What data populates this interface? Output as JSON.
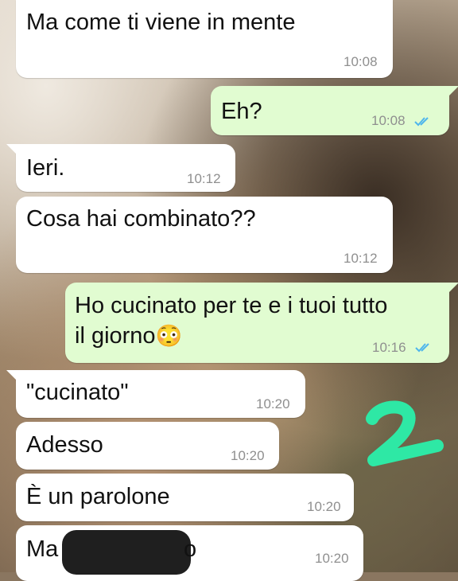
{
  "messages": [
    {
      "text": "Ma come ti viene in mente",
      "time": "10:08"
    },
    {
      "text": "Eh?",
      "time": "10:08"
    },
    {
      "text": "Ieri.",
      "time": "10:12"
    },
    {
      "text": "Cosa hai combinato??",
      "time": "10:12"
    },
    {
      "line1": "Ho cucinato per te e i tuoi tutto",
      "line2": "il giorno",
      "emoji": "😳",
      "time": "10:16"
    },
    {
      "text": "\"cucinato\"",
      "time": "10:20"
    },
    {
      "text": "Adesso",
      "time": "10:20"
    },
    {
      "text": "È un parolone",
      "time": "10:20"
    },
    {
      "text_start": "Ma",
      "text_end": "o",
      "time": "10:20"
    }
  ],
  "annotation": "2",
  "colors": {
    "incoming": "#ffffff",
    "outgoing": "#e1fcd1",
    "read_ticks": "#4fb6ec",
    "annotation": "#2ee8a5"
  }
}
